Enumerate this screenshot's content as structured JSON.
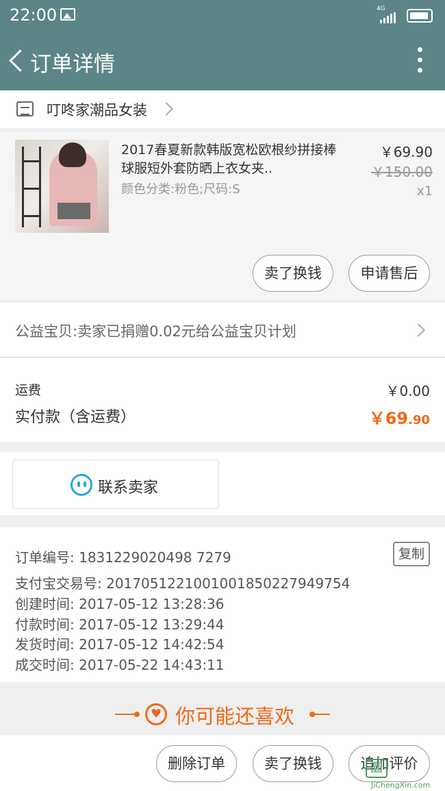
{
  "status_bar": {
    "time": "22:00",
    "network": "4G"
  },
  "header": {
    "title": "订单详情"
  },
  "shop": {
    "name": "叮咚家潮品女装"
  },
  "product": {
    "title": "2017春夏新款韩版宽松欧根纱拼接棒球服短外套防晒上衣女夹..",
    "attributes": "颜色分类:粉色;尺码:S",
    "price": "￥69.90",
    "original_price": "￥150.00",
    "quantity": "x1",
    "actions": {
      "sell": "卖了换钱",
      "after_sale": "申请售后"
    }
  },
  "charity": {
    "text": "公益宝贝:卖家已捐赠0.02元给公益宝贝计划"
  },
  "fees": {
    "shipping_label": "运费",
    "shipping_value": "￥0.00",
    "paid_label": "实付款（含运费）",
    "paid_currency": "￥",
    "paid_int": "69",
    "paid_dec": ".90"
  },
  "contact": {
    "label": "联系卖家"
  },
  "order_info": {
    "copy_label": "复制",
    "rows": [
      "订单编号: 1831229020498 7279",
      "支付宝交易号: 2017051221001001850227949754",
      "创建时间: 2017-05-12 13:28:36",
      "付款时间: 2017-05-12 13:29:44",
      "发货时间: 2017-05-12 14:42:54",
      "成交时间: 2017-05-22 14:43:11"
    ]
  },
  "recommend": {
    "text": "你可能还喜欢"
  },
  "bottom_actions": {
    "delete": "删除订单",
    "sell": "卖了换钱",
    "review": "追加评价"
  },
  "watermark": {
    "text": "JiChengXin.com"
  },
  "colors": {
    "header": "#5b8586",
    "accent": "#f06a1a",
    "contact_icon": "#2aa5e3"
  }
}
